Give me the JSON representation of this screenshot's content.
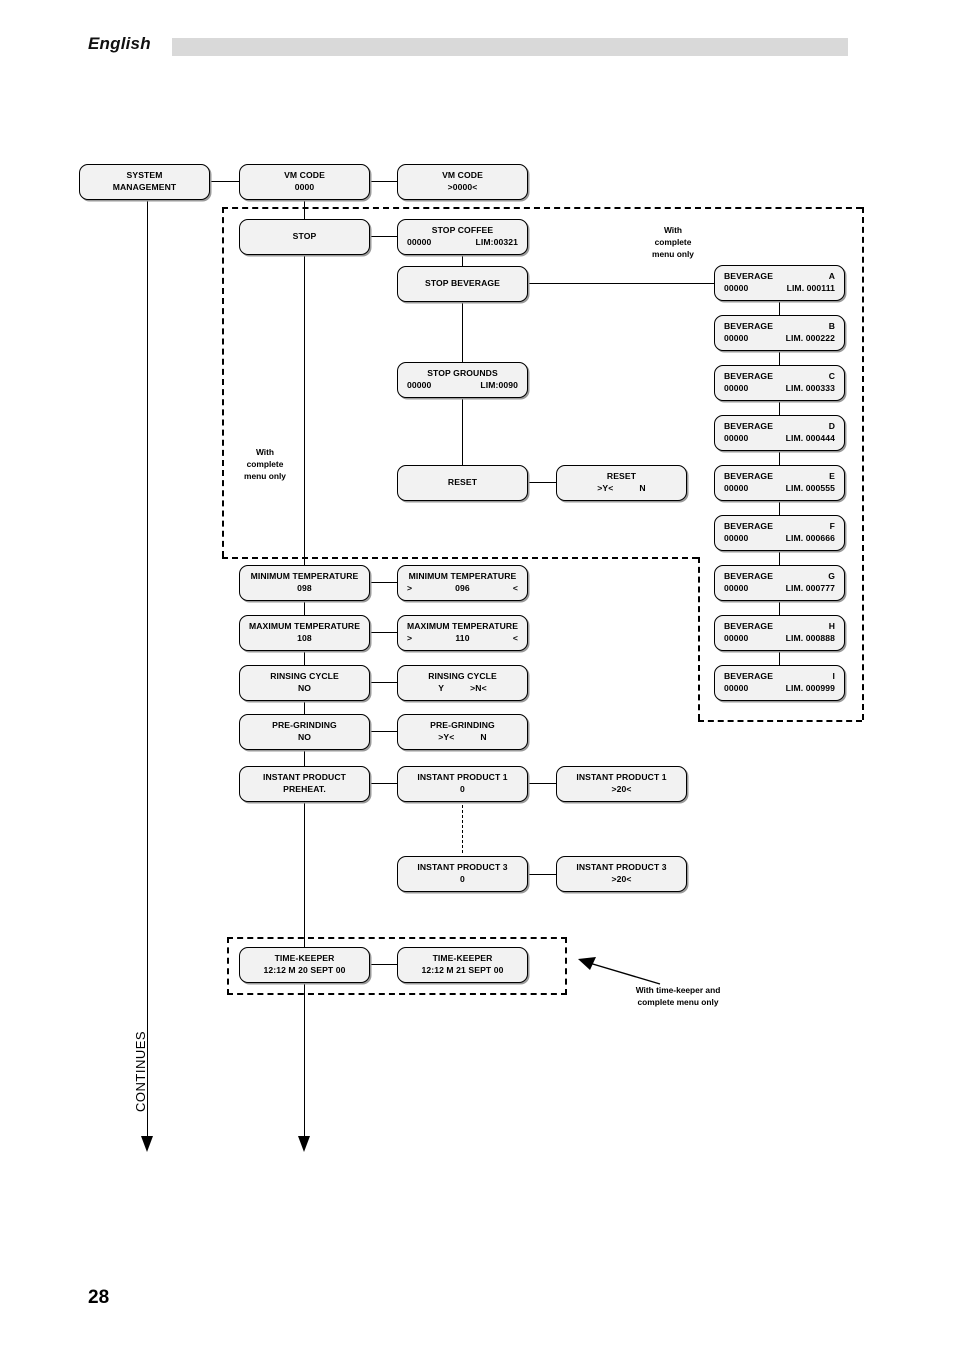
{
  "header": {
    "language": "English"
  },
  "footer": {
    "page_number": "28"
  },
  "continues_label": "CONTINUES",
  "notes": {
    "complete_menu_left": "With\ncomplete\nmenu only",
    "complete_menu_right": "With\ncomplete\nmenu only",
    "timekeeper": "With time-keeper and\ncomplete menu only"
  },
  "chart_data": {
    "type": "diagram",
    "title": "SYSTEM MANAGEMENT menu flow",
    "nodes": [
      {
        "id": "system-management",
        "l1": "SYSTEM",
        "l2": "MANAGEMENT"
      },
      {
        "id": "vm-code",
        "l1": "VM CODE",
        "l2": "0000"
      },
      {
        "id": "vm-code-edit",
        "l1": "VM CODE",
        "l2": ">0000<"
      },
      {
        "id": "stop",
        "l1": "STOP",
        "l2": ""
      },
      {
        "id": "stop-coffee",
        "l1": "STOP COFFEE",
        "left": "00000",
        "right": "LIM:00321"
      },
      {
        "id": "stop-beverage",
        "l1": "STOP BEVERAGE",
        "l2": ""
      },
      {
        "id": "stop-grounds",
        "l1": "STOP GROUNDS",
        "left": "00000",
        "right": "LIM:0090"
      },
      {
        "id": "reset",
        "l1": "RESET",
        "l2": ""
      },
      {
        "id": "reset-confirm",
        "l1": "RESET",
        "left2": ">Y<",
        "right2": "N"
      },
      {
        "id": "minimum-temperature",
        "l1": "MINIMUM TEMPERATURE",
        "l2": "098"
      },
      {
        "id": "minimum-temperature-edit",
        "l1": "MINIMUM TEMPERATURE",
        "gt": ">",
        "mid": "096",
        "lt": "<"
      },
      {
        "id": "maximum-temperature",
        "l1": "MAXIMUM TEMPERATURE",
        "l2": "108"
      },
      {
        "id": "maximum-temperature-edit",
        "l1": "MAXIMUM TEMPERATURE",
        "gt": ">",
        "mid": "110",
        "lt": "<"
      },
      {
        "id": "rinsing-cycle",
        "l1": "RINSING CYCLE",
        "l2": "NO"
      },
      {
        "id": "rinsing-cycle-edit",
        "l1": "RINSING CYCLE",
        "left2": "Y",
        "right2": ">N<"
      },
      {
        "id": "pre-grinding",
        "l1": "PRE-GRINDING",
        "l2": "NO"
      },
      {
        "id": "pre-grinding-edit",
        "l1": "PRE-GRINDING",
        "left2": ">Y<",
        "right2": "N"
      },
      {
        "id": "instant-product-preheat",
        "l1": "INSTANT PRODUCT",
        "l2": "PREHEAT."
      },
      {
        "id": "instant-product-1",
        "l1": "INSTANT PRODUCT 1",
        "l2": "0"
      },
      {
        "id": "instant-product-1-edit",
        "l1": "INSTANT PRODUCT 1",
        "l2": ">20<"
      },
      {
        "id": "instant-product-3",
        "l1": "INSTANT PRODUCT  3",
        "l2": "0"
      },
      {
        "id": "instant-product-3-edit",
        "l1": "INSTANT PRODUCT  3",
        "l2": ">20<"
      },
      {
        "id": "time-keeper",
        "l1": "TIME-KEEPER",
        "l2": "12:12 M 20 SEPT 00"
      },
      {
        "id": "time-keeper-edit",
        "l1": "TIME-KEEPER",
        "l2": "12:12 M 21 SEPT 00"
      }
    ],
    "beverages": [
      {
        "id": "beverage-a",
        "label": "BEVERAGE",
        "letter": "A",
        "count": "00000",
        "limit": "LIM. 000111"
      },
      {
        "id": "beverage-b",
        "label": "BEVERAGE",
        "letter": "B",
        "count": "00000",
        "limit": "LIM. 000222"
      },
      {
        "id": "beverage-c",
        "label": "BEVERAGE",
        "letter": "C",
        "count": "00000",
        "limit": "LIM. 000333"
      },
      {
        "id": "beverage-d",
        "label": "BEVERAGE",
        "letter": "D",
        "count": "00000",
        "limit": "LIM. 000444"
      },
      {
        "id": "beverage-e",
        "label": "BEVERAGE",
        "letter": "E",
        "count": "00000",
        "limit": "LIM. 000555"
      },
      {
        "id": "beverage-f",
        "label": "BEVERAGE",
        "letter": "F",
        "count": "00000",
        "limit": "LIM. 000666"
      },
      {
        "id": "beverage-g",
        "label": "BEVERAGE",
        "letter": "G",
        "count": "00000",
        "limit": "LIM. 000777"
      },
      {
        "id": "beverage-h",
        "label": "BEVERAGE",
        "letter": "H",
        "count": "00000",
        "limit": "LIM. 000888"
      },
      {
        "id": "beverage-i",
        "label": "BEVERAGE",
        "letter": "I",
        "count": "00000",
        "limit": "LIM. 000999"
      }
    ]
  },
  "boxes": {
    "system_management": {
      "l1": "SYSTEM",
      "l2": "MANAGEMENT"
    },
    "vm_code": {
      "l1": "VM CODE",
      "l2": "0000"
    },
    "vm_code_edit": {
      "l1": "VM CODE",
      "l2": ">0000<"
    },
    "stop": {
      "l1": "STOP"
    },
    "stop_coffee": {
      "l1": "STOP COFFEE",
      "left": "00000",
      "right": "LIM:00321"
    },
    "stop_beverage": {
      "l1": "STOP BEVERAGE"
    },
    "stop_grounds": {
      "l1": "STOP GROUNDS",
      "left": "00000",
      "right": "LIM:0090"
    },
    "reset": {
      "l1": "RESET"
    },
    "reset_confirm": {
      "l1": "RESET",
      "left": ">Y<",
      "right": "N"
    },
    "min_temp": {
      "l1": "MINIMUM TEMPERATURE",
      "l2": "098"
    },
    "min_temp_edit": {
      "l1": "MINIMUM TEMPERATURE",
      "gt": ">",
      "mid": "096",
      "lt": "<"
    },
    "max_temp": {
      "l1": "MAXIMUM TEMPERATURE",
      "l2": "108"
    },
    "max_temp_edit": {
      "l1": "MAXIMUM TEMPERATURE",
      "gt": ">",
      "mid": "110",
      "lt": "<"
    },
    "rinsing": {
      "l1": "RINSING CYCLE",
      "l2": "NO"
    },
    "rinsing_edit": {
      "l1": "RINSING CYCLE",
      "left": "Y",
      "right": ">N<"
    },
    "pregrinding": {
      "l1": "PRE-GRINDING",
      "l2": "NO"
    },
    "pregrinding_edit": {
      "l1": "PRE-GRINDING",
      "left": ">Y<",
      "right": "N"
    },
    "instant_preheat": {
      "l1": "INSTANT PRODUCT",
      "l2": "PREHEAT."
    },
    "instant_1": {
      "l1": "INSTANT PRODUCT 1",
      "l2": "0"
    },
    "instant_1_edit": {
      "l1": "INSTANT PRODUCT 1",
      "l2": ">20<"
    },
    "instant_3": {
      "l1": "INSTANT PRODUCT  3",
      "l2": "0"
    },
    "instant_3_edit": {
      "l1": "INSTANT PRODUCT  3",
      "l2": ">20<"
    },
    "timekeeper": {
      "l1": "TIME-KEEPER",
      "l2": "12:12 M 20 SEPT 00"
    },
    "timekeeper_edit": {
      "l1": "TIME-KEEPER",
      "l2": "12:12 M 21 SEPT 00"
    },
    "bev_a": {
      "label": "BEVERAGE",
      "letter": "A",
      "count": "00000",
      "limit": "LIM. 000111"
    },
    "bev_b": {
      "label": "BEVERAGE",
      "letter": "B",
      "count": "00000",
      "limit": "LIM. 000222"
    },
    "bev_c": {
      "label": "BEVERAGE",
      "letter": "C",
      "count": "00000",
      "limit": "LIM. 000333"
    },
    "bev_d": {
      "label": "BEVERAGE",
      "letter": "D",
      "count": "00000",
      "limit": "LIM. 000444"
    },
    "bev_e": {
      "label": "BEVERAGE",
      "letter": "E",
      "count": "00000",
      "limit": "LIM. 000555"
    },
    "bev_f": {
      "label": "BEVERAGE",
      "letter": "F",
      "count": "00000",
      "limit": "LIM. 000666"
    },
    "bev_g": {
      "label": "BEVERAGE",
      "letter": "G",
      "count": "00000",
      "limit": "LIM. 000777"
    },
    "bev_h": {
      "label": "BEVERAGE",
      "letter": "H",
      "count": "00000",
      "limit": "LIM. 000888"
    },
    "bev_i": {
      "label": "BEVERAGE",
      "letter": "I",
      "count": "00000",
      "limit": "LIM. 000999"
    }
  }
}
